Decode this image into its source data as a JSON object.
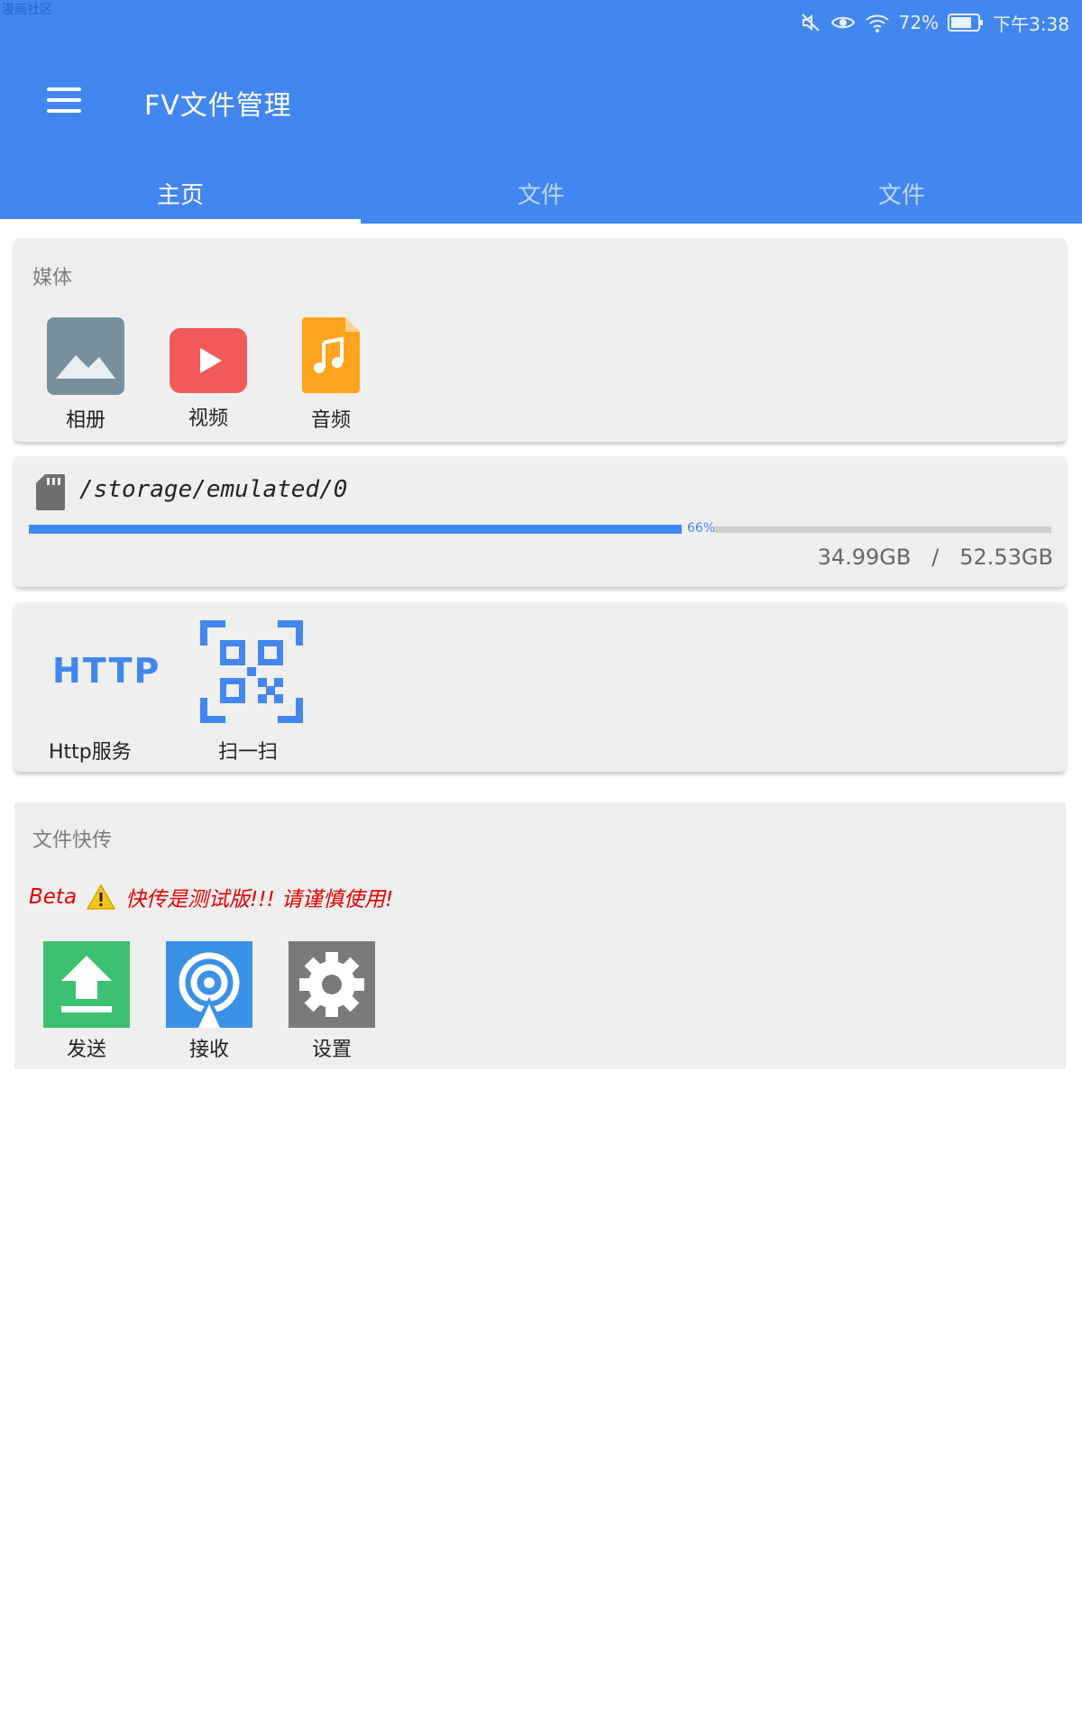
{
  "top_label": "漫画社区",
  "status_bar": {
    "battery": "72%",
    "time": "下午3:38",
    "icons": [
      "mute-icon",
      "eye-icon",
      "wifi-icon",
      "battery-icon"
    ]
  },
  "app_bar": {
    "menu_icon": "hamburger-icon",
    "title": "FV文件管理",
    "color": "#4287ef"
  },
  "tabs": [
    {
      "label": "主页",
      "active": true
    },
    {
      "label": "文件",
      "active": false
    },
    {
      "label": "文件",
      "active": false
    }
  ],
  "media": {
    "title": "媒体",
    "items": [
      {
        "label": "相册",
        "icon": "gallery-icon",
        "color": "#78909c"
      },
      {
        "label": "视频",
        "icon": "video-play-icon",
        "color": "#f05a5a"
      },
      {
        "label": "音频",
        "icon": "music-file-icon",
        "color": "#ffa41f"
      }
    ]
  },
  "storage": {
    "icon": "sd-card-icon",
    "path": "/storage/emulated/0",
    "used_percent": 66,
    "used_percent_label": "66%",
    "used": "34.99GB",
    "separator": "/",
    "total": "52.53GB"
  },
  "tools": {
    "http": {
      "icon_text": "HTTP",
      "label": "Http服务"
    },
    "scan": {
      "icon": "qr-scan-icon",
      "label": "扫一扫"
    }
  },
  "transfer": {
    "title": "文件快传",
    "beta_prefix": "Beta",
    "warning_icon": "warning-icon",
    "beta_text": "快传是测试版!!! 请谨慎使用!",
    "items": [
      {
        "label": "发送",
        "icon": "upload-icon",
        "color": "#3cc072"
      },
      {
        "label": "接收",
        "icon": "receive-signal-icon",
        "color": "#3a91e6"
      },
      {
        "label": "设置",
        "icon": "gear-icon",
        "color": "#7a7a7a"
      }
    ]
  }
}
